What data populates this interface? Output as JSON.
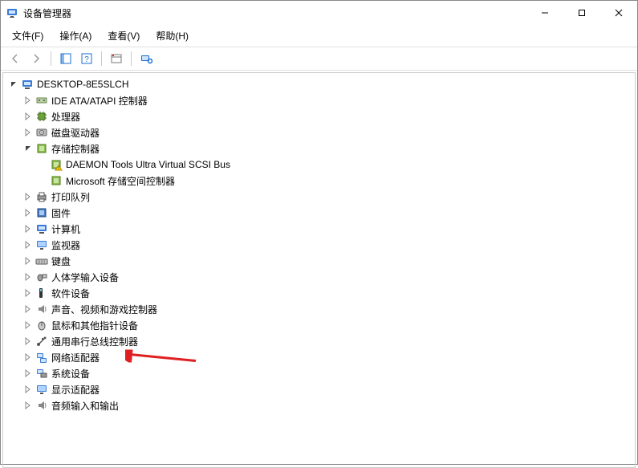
{
  "window": {
    "title": "设备管理器"
  },
  "menus": {
    "file": "文件(F)",
    "action": "操作(A)",
    "view": "查看(V)",
    "help": "帮助(H)"
  },
  "tree": {
    "root": "DESKTOP-8E5SLCH",
    "items": [
      {
        "label": "IDE ATA/ATAPI 控制器",
        "icon": "ide",
        "expanded": false
      },
      {
        "label": "处理器",
        "icon": "cpu",
        "expanded": false
      },
      {
        "label": "磁盘驱动器",
        "icon": "disk",
        "expanded": false
      },
      {
        "label": "存储控制器",
        "icon": "storage",
        "expanded": true,
        "children": [
          {
            "label": "DAEMON Tools Ultra Virtual SCSI Bus",
            "icon": "storage-warn"
          },
          {
            "label": "Microsoft 存储空间控制器",
            "icon": "storage"
          }
        ]
      },
      {
        "label": "打印队列",
        "icon": "printer",
        "expanded": false
      },
      {
        "label": "固件",
        "icon": "firmware",
        "expanded": false
      },
      {
        "label": "计算机",
        "icon": "computer",
        "expanded": false
      },
      {
        "label": "监视器",
        "icon": "monitor",
        "expanded": false
      },
      {
        "label": "键盘",
        "icon": "keyboard",
        "expanded": false
      },
      {
        "label": "人体学输入设备",
        "icon": "hid",
        "expanded": false
      },
      {
        "label": "软件设备",
        "icon": "software",
        "expanded": false
      },
      {
        "label": "声音、视频和游戏控制器",
        "icon": "audio",
        "expanded": false
      },
      {
        "label": "鼠标和其他指针设备",
        "icon": "mouse",
        "expanded": false
      },
      {
        "label": "通用串行总线控制器",
        "icon": "usb",
        "expanded": false
      },
      {
        "label": "网络适配器",
        "icon": "network",
        "expanded": false,
        "highlight": true
      },
      {
        "label": "系统设备",
        "icon": "system",
        "expanded": false
      },
      {
        "label": "显示适配器",
        "icon": "display",
        "expanded": false
      },
      {
        "label": "音频输入和输出",
        "icon": "audioio",
        "expanded": false
      }
    ]
  }
}
